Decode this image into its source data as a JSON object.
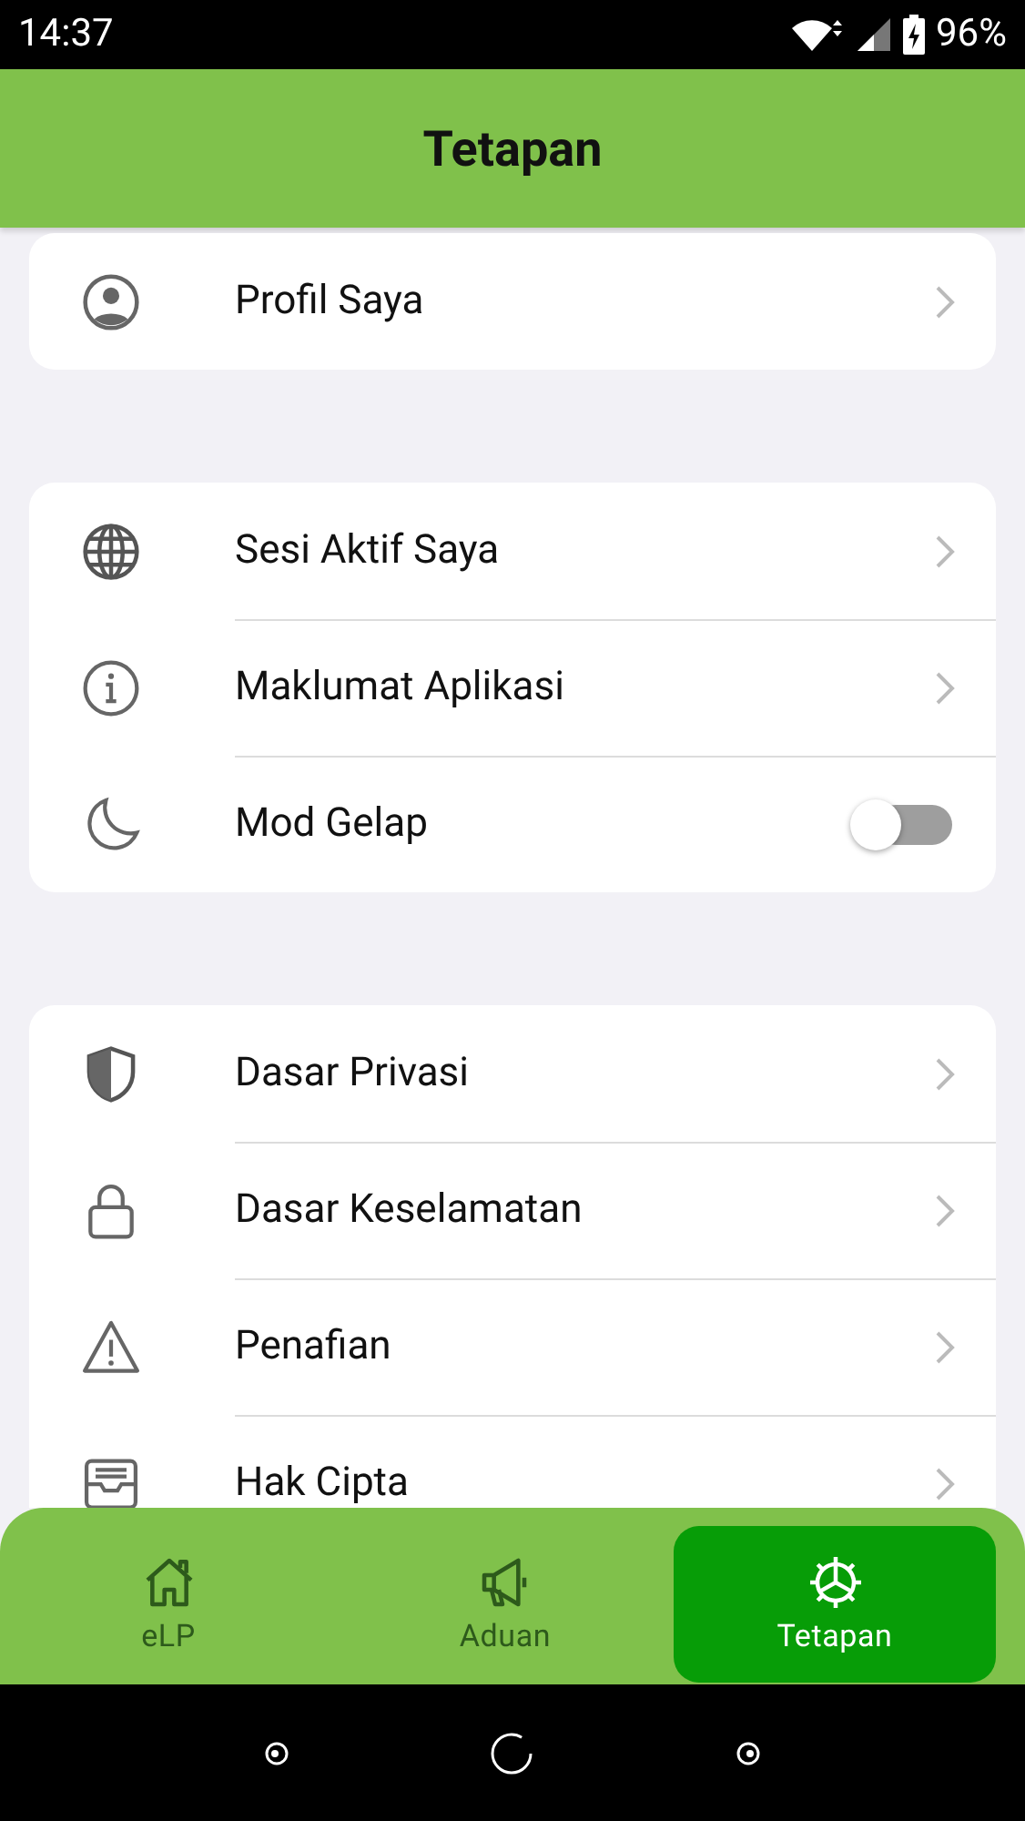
{
  "status_bar": {
    "time": "14:37",
    "battery": "96%"
  },
  "header": {
    "title": "Tetapan"
  },
  "groups": [
    {
      "rows": [
        {
          "kind": "link",
          "label": "Profil Saya"
        }
      ]
    },
    {
      "rows": [
        {
          "kind": "link",
          "label": "Sesi Aktif Saya"
        },
        {
          "kind": "link",
          "label": "Maklumat Aplikasi"
        },
        {
          "kind": "toggle",
          "label": "Mod Gelap",
          "on": false
        }
      ]
    },
    {
      "rows": [
        {
          "kind": "link",
          "label": "Dasar Privasi"
        },
        {
          "kind": "link",
          "label": "Dasar Keselamatan"
        },
        {
          "kind": "link",
          "label": "Penafian"
        },
        {
          "kind": "link",
          "label": "Hak Cipta"
        }
      ]
    }
  ],
  "bottom_nav": {
    "items": [
      {
        "label": "eLP",
        "selected": false
      },
      {
        "label": "Aduan",
        "selected": false
      },
      {
        "label": "Tetapan",
        "selected": true
      }
    ]
  }
}
